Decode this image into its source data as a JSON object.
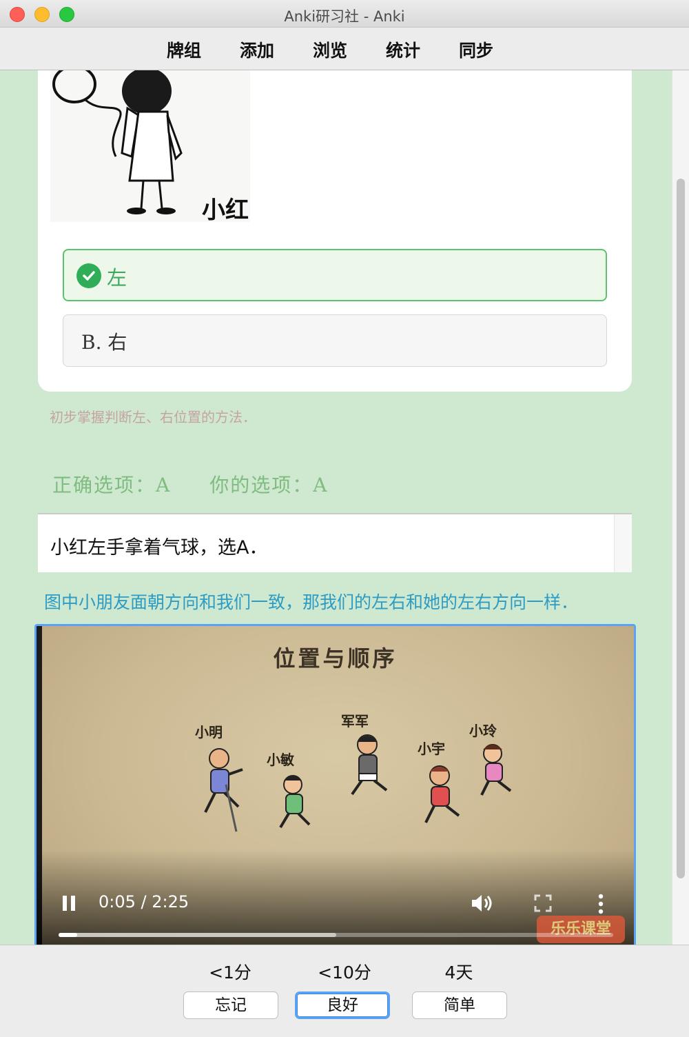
{
  "window": {
    "title": "Anki研习社 - Anki"
  },
  "toolbar": {
    "items": [
      "牌组",
      "添加",
      "浏览",
      "统计",
      "同步"
    ]
  },
  "card": {
    "image_caption": "小红",
    "option_a": "左",
    "option_b": "B. 右",
    "hint": "初步掌握判断左、右位置的方法．",
    "correct_answer": "正确选项：A",
    "your_answer": "你的选项：A",
    "explanation": "小红左手拿着气球，选A．",
    "explanation_detail": "图中小朋友面朝方向和我们一致，那我们的左右和她的左右方向一样．"
  },
  "video": {
    "title": "位置与顺序",
    "names": [
      "小明",
      "小敏",
      "军军",
      "小宇",
      "小玲"
    ],
    "time_display": "0:05 / 2:25",
    "played_fraction": 0.034,
    "buffered_fraction": 0.5,
    "logo_text": "乐乐课堂"
  },
  "answer_bar": {
    "intervals": [
      "<1分",
      "<10分",
      "4天"
    ],
    "buttons": [
      "忘记",
      "良好",
      "简单"
    ]
  },
  "colors": {
    "correct": "#2fae57",
    "hint": "#c6a3a3",
    "info_blue": "#2c9cc4",
    "focus": "#5aa3f4"
  }
}
